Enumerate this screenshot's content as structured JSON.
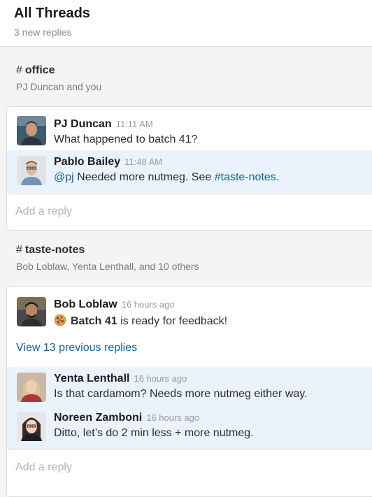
{
  "header": {
    "title": "All Threads",
    "subtitle": "3 new replies"
  },
  "threads": [
    {
      "channel": "office",
      "members": "PJ Duncan and you",
      "messages": [
        {
          "author": "PJ Duncan",
          "time": "11:11 AM",
          "text": "What happened to batch 41?",
          "avatar": "pj-duncan-avatar"
        },
        {
          "author": "Pablo Bailey",
          "time": "11:48 AM",
          "mention": "@pj",
          "text": "Needed more nutmeg. See",
          "channel_link": "#taste-notes.",
          "avatar": "pablo-bailey-avatar"
        }
      ],
      "reply_placeholder": "Add a reply"
    },
    {
      "channel": "taste-notes",
      "members": "Bob Loblaw, Yenta Lenthall, and 10 others",
      "messages": [
        {
          "author": "Bob Loblaw",
          "time": "16 hours ago",
          "emoji": "cookie-icon",
          "bold_text": "Batch 41",
          "text": "is ready for feedback!",
          "avatar": "bob-loblaw-avatar"
        },
        {
          "author": "Yenta Lenthall",
          "time": "16 hours ago",
          "text": "Is that cardamom? Needs more nutmeg either way.",
          "avatar": "yenta-lenthall-avatar"
        },
        {
          "author": "Noreen Zamboni",
          "time": "16 hours ago",
          "text": "Ditto, let’s do 2 min less + more nutmeg.",
          "avatar": "noreen-zamboni-avatar"
        }
      ],
      "view_replies": "View 13 previous replies",
      "reply_placeholder": "Add a reply"
    }
  ],
  "colors": {
    "link": "#1264a3",
    "highlight": "#eaf2fb",
    "background": "#f4f4f4"
  }
}
